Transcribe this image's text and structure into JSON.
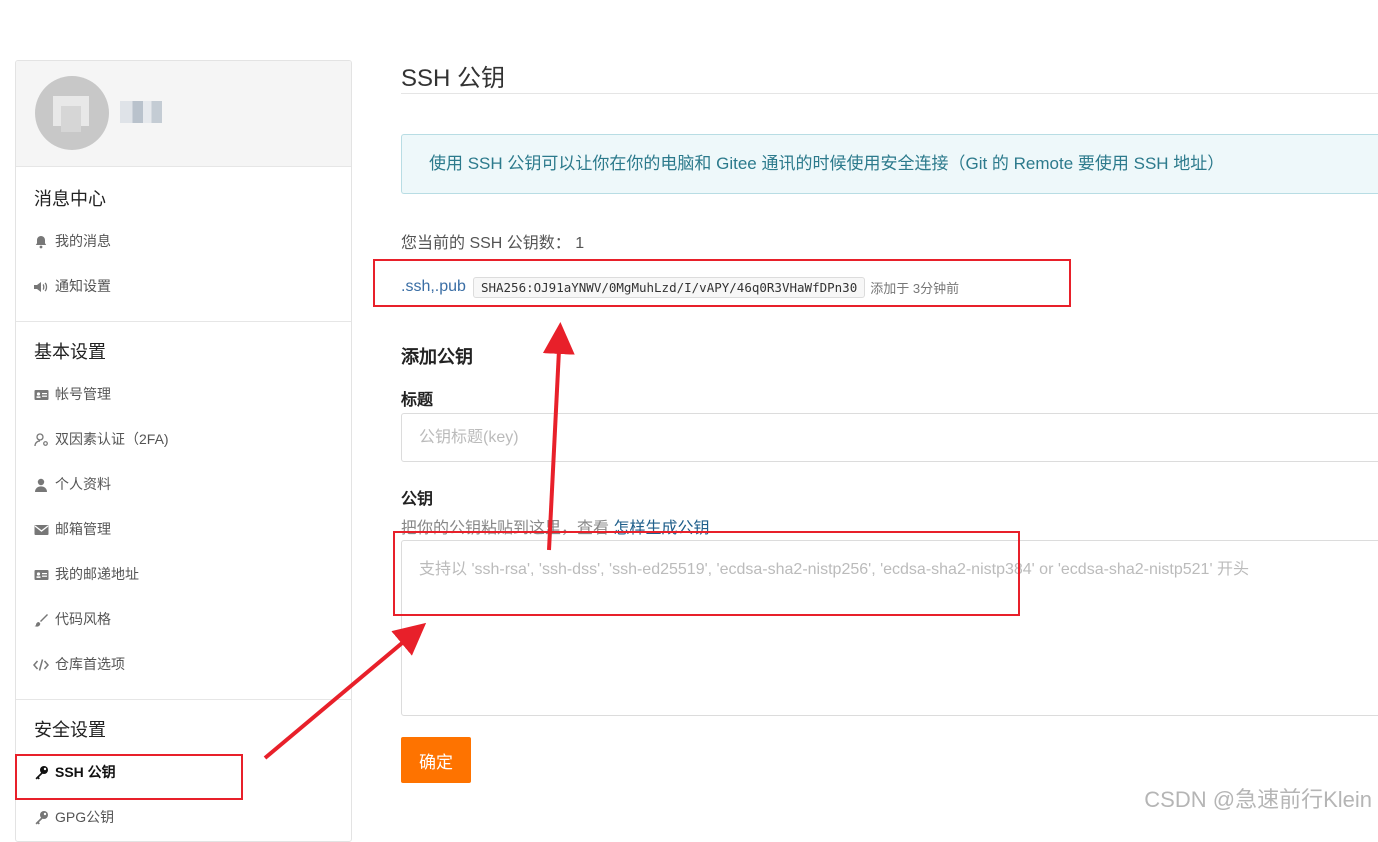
{
  "sidebar": {
    "sections": [
      {
        "title": "消息中心",
        "items": [
          {
            "icon": "bell-icon",
            "label": "我的消息"
          },
          {
            "icon": "speaker-icon",
            "label": "通知设置"
          }
        ]
      },
      {
        "title": "基本设置",
        "items": [
          {
            "icon": "id-card-icon",
            "label": "帐号管理"
          },
          {
            "icon": "user-key-icon",
            "label": "双因素认证（2FA)"
          },
          {
            "icon": "user-icon",
            "label": "个人资料"
          },
          {
            "icon": "envelope-icon",
            "label": "邮箱管理"
          },
          {
            "icon": "id-card-icon",
            "label": "我的邮递地址"
          },
          {
            "icon": "brush-icon",
            "label": "代码风格"
          },
          {
            "icon": "code-icon",
            "label": "仓库首选项"
          }
        ]
      },
      {
        "title": "安全设置",
        "items": [
          {
            "icon": "key-icon",
            "label": "SSH 公钥",
            "active": true
          },
          {
            "icon": "key-icon",
            "label": "GPG公钥"
          }
        ]
      }
    ]
  },
  "main": {
    "title": "SSH 公钥",
    "info": "使用 SSH 公钥可以让你在你的电脑和 Gitee 通讯的时候使用安全连接（Git 的 Remote 要使用 SSH 地址）",
    "count_label": "您当前的 SSH 公钥数：",
    "count_value": "1",
    "keys": [
      {
        "name": ".ssh,.pub",
        "fingerprint": "SHA256:OJ91aYNWV/0MgMuhLzd/I/vAPY/46q0R3VHaWfDPn30",
        "added": "添加于 3分钟前"
      }
    ],
    "form": {
      "heading": "添加公钥",
      "title_label": "标题",
      "title_placeholder": "公钥标题(key)",
      "key_label": "公钥",
      "hint_prefix": "把你的公钥粘贴到这里，查看 ",
      "hint_link": "怎样生成公钥",
      "key_placeholder": "支持以 'ssh-rsa', 'ssh-dss', 'ssh-ed25519', 'ecdsa-sha2-nistp256', 'ecdsa-sha2-nistp384' or 'ecdsa-sha2-nistp521' 开头",
      "submit_label": "确定"
    }
  },
  "colors": {
    "accent": "#fe7300",
    "info_text": "#2c7a8c",
    "annotation": "#e8202a"
  },
  "watermark": "CSDN @急速前行Klein"
}
